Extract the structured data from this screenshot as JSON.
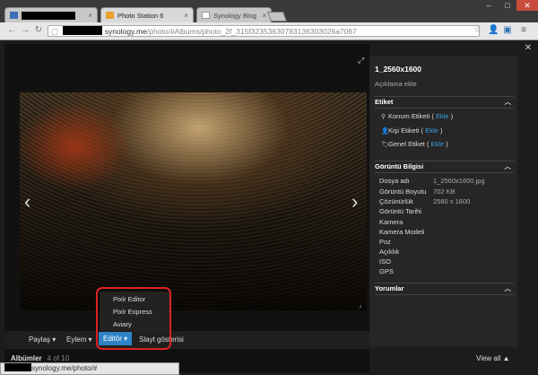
{
  "browser": {
    "tabs": [
      {
        "label": "",
        "redacted": true
      },
      {
        "label": "Photo Station 6"
      },
      {
        "label": "Synology Blog"
      }
    ],
    "url_host": "synology.me",
    "url_path": "/photo/#Albums/photo_2f_315f32353630783136303026a7067",
    "window_controls": [
      "minimize-icon",
      "maximize-icon",
      "close-icon"
    ],
    "toolbar_icons": [
      "star-icon",
      "person-icon",
      "extension-icon",
      "menu-icon"
    ]
  },
  "viewer": {
    "prev_icon": "‹",
    "next_icon": "›",
    "expand_icon": "⤢",
    "bottom": {
      "share": "Paylaş ▾",
      "action": "Eylem ▾",
      "editor": "Editör ▾",
      "slideshow": "Slayt gösterisi"
    },
    "editor_menu": [
      "Pixlr Editor",
      "Pixlr Express",
      "Aviary"
    ]
  },
  "albums": {
    "label": "Albümler",
    "count": "4 of 10",
    "view_all": "View all ▲"
  },
  "status_url": "synology.me/photo/#",
  "panel": {
    "title": "1_2560x1600",
    "description": "Açıklama ekle",
    "tags_header": "Etiket",
    "tags": [
      {
        "label": "Konum Etiketi",
        "icon": "location-icon"
      },
      {
        "label": "Kişi Etiketi",
        "icon": "person-icon"
      },
      {
        "label": "Genel Etiket",
        "icon": "tag-icon"
      }
    ],
    "add_label": "Ekle",
    "info_header": "Görüntü Bilgisi",
    "info": [
      {
        "k": "Dosya adı",
        "v": "1_2560x1600.jpg"
      },
      {
        "k": "Görüntü Boyutu",
        "v": "702 KB"
      },
      {
        "k": "Çözünürlük",
        "v": "2560 x 1600"
      },
      {
        "k": "Görüntü Tarihi",
        "v": ""
      },
      {
        "k": "Kamera",
        "v": ""
      },
      {
        "k": "Kamera Modeli",
        "v": ""
      },
      {
        "k": "Poz",
        "v": ""
      },
      {
        "k": "Açıklık",
        "v": ""
      },
      {
        "k": "ISO",
        "v": ""
      },
      {
        "k": "GPS",
        "v": ""
      }
    ],
    "comments_header": "Yorumlar"
  },
  "colors": {
    "accent": "#2e84c6",
    "link": "#39a1e6",
    "highlight": "#d22222"
  }
}
